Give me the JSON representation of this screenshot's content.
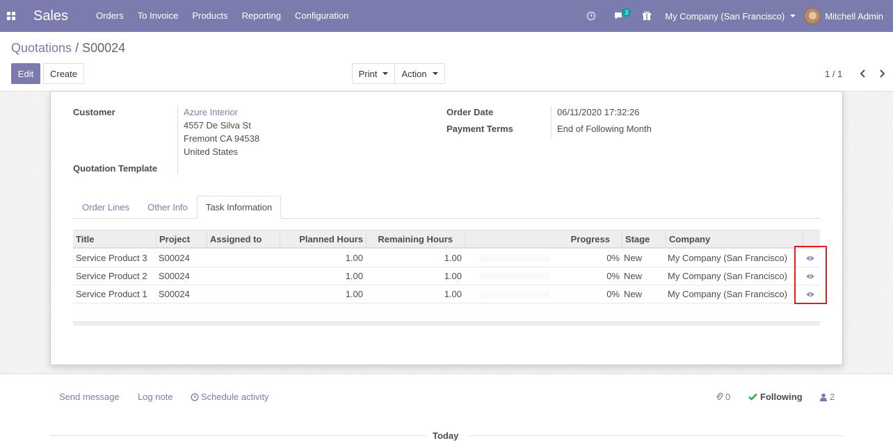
{
  "navbar": {
    "app_name": "Sales",
    "menu": [
      "Orders",
      "To Invoice",
      "Products",
      "Reporting",
      "Configuration"
    ],
    "messages_count": "3",
    "company": "My Company (San Francisco)",
    "user": "Mitchell Admin"
  },
  "breadcrumb": {
    "parent": "Quotations",
    "separator": "/",
    "current": "S00024"
  },
  "buttons": {
    "edit": "Edit",
    "create": "Create",
    "print": "Print",
    "action": "Action"
  },
  "pager": {
    "value": "1 / 1"
  },
  "form": {
    "customer_label": "Customer",
    "customer_name": "Azure Interior",
    "address_line1": "4557 De Silva St",
    "address_line2": "Fremont CA 94538",
    "address_line3": "United States",
    "quotation_template_label": "Quotation Template",
    "order_date_label": "Order Date",
    "order_date": "06/11/2020 17:32:26",
    "payment_terms_label": "Payment Terms",
    "payment_terms": "End of Following Month"
  },
  "tabs": [
    "Order Lines",
    "Other Info",
    "Task Information"
  ],
  "table": {
    "headers": [
      "Title",
      "Project",
      "Assigned to",
      "Planned Hours",
      "Remaining Hours",
      "Progress",
      "Stage",
      "Company"
    ],
    "rows": [
      {
        "title": "Service Product 3",
        "project": "S00024",
        "assigned": "",
        "planned": "1.00",
        "remaining": "1.00",
        "progress": "0%",
        "progress_value": 0,
        "stage": "New",
        "company": "My Company (San Francisco)"
      },
      {
        "title": "Service Product 2",
        "project": "S00024",
        "assigned": "",
        "planned": "1.00",
        "remaining": "1.00",
        "progress": "0%",
        "progress_value": 0,
        "stage": "New",
        "company": "My Company (San Francisco)"
      },
      {
        "title": "Service Product 1",
        "project": "S00024",
        "assigned": "",
        "planned": "1.00",
        "remaining": "1.00",
        "progress": "0%",
        "progress_value": 0,
        "stage": "New",
        "company": "My Company (San Francisco)"
      }
    ]
  },
  "chatter": {
    "send_message": "Send message",
    "log_note": "Log note",
    "schedule_activity": "Schedule activity",
    "attachments": "0",
    "following": "Following",
    "followers": "2",
    "today": "Today"
  },
  "colors": {
    "brand": "#7c7bad",
    "highlight": "#e02020",
    "following_check": "#28a745"
  }
}
